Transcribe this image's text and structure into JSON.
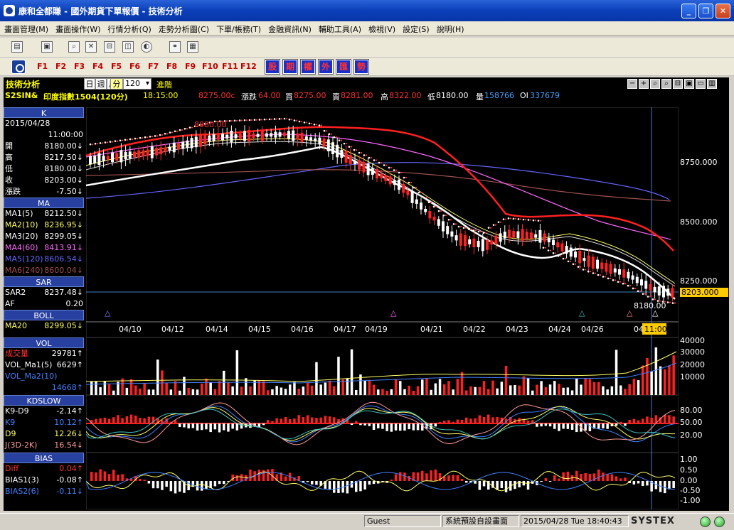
{
  "window": {
    "title": "康和全都賺 - 國外期貨下單報價 - 技術分析",
    "minimize": "_",
    "restore": "❐",
    "close": "✕"
  },
  "menu": [
    "畫面管理(M)",
    "畫面操作(W)",
    "行情分析(Q)",
    "走勢分析圖(C)",
    "下單/帳務(T)",
    "金融資訊(N)",
    "輔助工具(A)",
    "檢視(V)",
    "設定(S)",
    "說明(H)"
  ],
  "fkeys": [
    "F1",
    "F2",
    "F3",
    "F4",
    "F5",
    "F6",
    "F7",
    "F8",
    "F9",
    "F10",
    "F11",
    "F12"
  ],
  "category_buttons": [
    "股",
    "期",
    "權",
    "外",
    "匯",
    "勢"
  ],
  "chart_header": {
    "title": "技術分析",
    "periods": [
      "日",
      "週",
      "月",
      "分"
    ],
    "period_value": "120",
    "advanced": "進階",
    "symbol": "S2SIN&",
    "name": "印度指數1504(120分)",
    "time": "18:15:00",
    "last": "8275.00c",
    "change_label": "漲跌",
    "change": "64.00",
    "bid_label": "買",
    "bid": "8275.00",
    "ask_label": "賣",
    "ask": "8281.00",
    "high_label": "高",
    "high": "8322.00",
    "low_label": "低",
    "low": "8180.00",
    "vol_label": "量",
    "vol": "158766",
    "oi_label": "OI",
    "oi": "337679",
    "zoom_buttons": [
      "−",
      "+",
      "⌕",
      "⌕",
      "⊟",
      "▣",
      "▭",
      "▥"
    ]
  },
  "left_panel": {
    "k": {
      "section": "K",
      "date": "2015/04/28",
      "time": "11:00:00",
      "rows": [
        {
          "label": "開",
          "value": "8180.00↓"
        },
        {
          "label": "高",
          "value": "8217.50↓"
        },
        {
          "label": "低",
          "value": "8180.00↓"
        },
        {
          "label": "收",
          "value": "8203.00↓"
        },
        {
          "label": "漲跌",
          "value": "-7.50↓"
        }
      ]
    },
    "ma": {
      "section": "MA",
      "rows": [
        {
          "label": "MA1(5)",
          "value": "8212.50↓",
          "color": "#ffffff"
        },
        {
          "label": "MA2(10)",
          "value": "8236.95↓",
          "color": "#ffff66"
        },
        {
          "label": "MA3(20)",
          "value": "8299.05↓",
          "color": "#ffffff"
        },
        {
          "label": "MA4(60)",
          "value": "8413.91↓",
          "color": "#ff66ff"
        },
        {
          "label": "MA5(120)",
          "value": "8606.54↓",
          "color": "#6666ff"
        },
        {
          "label": "MA6(240)",
          "value": "8600.04↓",
          "color": "#a05050"
        }
      ]
    },
    "sar": {
      "section": "SAR",
      "rows": [
        {
          "label": "SAR2",
          "value": "8237.48↓"
        },
        {
          "label": "AF",
          "value": "0.20"
        }
      ]
    },
    "boll": {
      "section": "BOLL",
      "rows": [
        {
          "label": "MA20",
          "value": "8299.05↓"
        }
      ]
    },
    "vol": {
      "section": "VOL",
      "rows": [
        {
          "label": "成交量",
          "value": "29781↑",
          "color": "#ff3333"
        },
        {
          "label": "VOL_Ma1(5)",
          "value": "6629↑",
          "color": "#ffffff"
        },
        {
          "label": "VOL_Ma2(10)",
          "value": "",
          "color": "#4080ff"
        },
        {
          "label": "",
          "value": "14668↑",
          "color": "#4080ff"
        }
      ]
    },
    "kd": {
      "section": "KDSLOW",
      "rows": [
        {
          "label": "K9-D9",
          "value": "-2.14↑",
          "color": "#ffffff"
        },
        {
          "label": "K9",
          "value": "10.12↑",
          "color": "#4080ff"
        },
        {
          "label": "D9",
          "value": "12.26↓",
          "color": "#ffff66"
        },
        {
          "label": "J(3D-2K)",
          "value": "16.54↓",
          "color": "#ff9999"
        }
      ]
    },
    "bias": {
      "section": "BIAS",
      "rows": [
        {
          "label": "Diff",
          "value": "0.04↑",
          "color": "#ff3333"
        },
        {
          "label": "BIAS1(3)",
          "value": "-0.08↑",
          "color": "#ffffff"
        },
        {
          "label": "BIAS2(6)",
          "value": "-0.11↓",
          "color": "#4080ff"
        }
      ]
    }
  },
  "price_axis": {
    "ticks": [
      "8750.000",
      "8500.000",
      "8250.000"
    ],
    "current": "8203.000",
    "high_mark": "8880.00",
    "low_mark": "8180.00"
  },
  "date_axis": [
    "04/10",
    "04/12",
    "04/14",
    "04/15",
    "04/16",
    "04/17",
    "04/19",
    "04/21",
    "04/22",
    "04/23",
    "04/24",
    "04/26",
    "04/"
  ],
  "cursor_time": "11:00",
  "vol_axis": [
    "40000",
    "30000",
    "20000",
    "10000"
  ],
  "kd_axis": [
    "80.00",
    "50.00",
    "20.00"
  ],
  "bias_axis": [
    "1.00",
    "0.50",
    "0.00",
    "-0.50",
    "-1.00"
  ],
  "status": {
    "user": "Guest",
    "layout": "系統預設自設畫面",
    "datetime": "2015/04/28 Tue 18:40:43",
    "brand": "SYSTEX"
  }
}
